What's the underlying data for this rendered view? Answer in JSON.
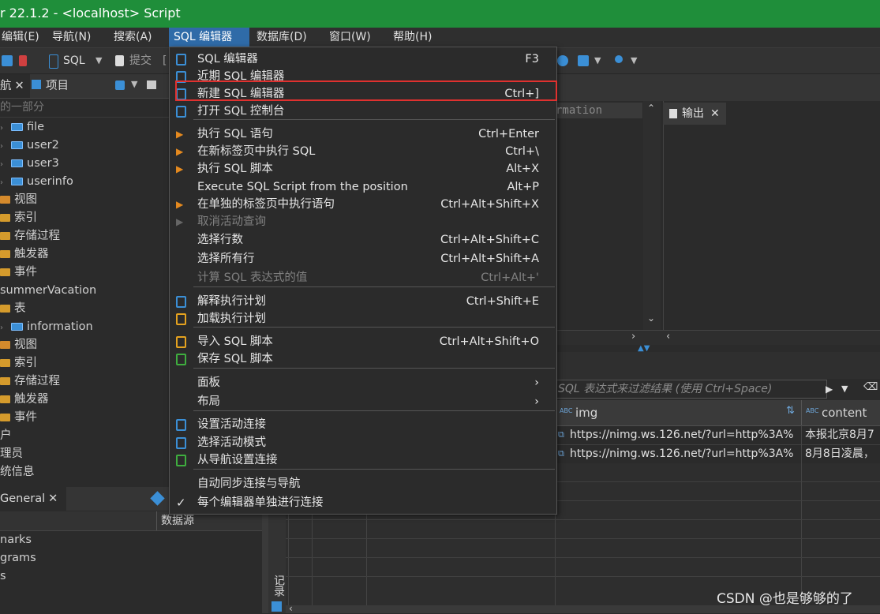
{
  "window": {
    "title": "r 22.1.2 - <localhost> Script"
  },
  "menubar": {
    "items": [
      {
        "label": "编辑(E)"
      },
      {
        "label": "导航(N)"
      },
      {
        "label": "搜索(A)"
      },
      {
        "label": "SQL 编辑器"
      },
      {
        "label": "数据库(D)"
      },
      {
        "label": "窗口(W)"
      },
      {
        "label": "帮助(H)"
      }
    ]
  },
  "toolbar": {
    "sql_label": "SQL",
    "submit_label": "提交"
  },
  "left_tabs": {
    "nav_label": "航",
    "project_label": "项目"
  },
  "filter_hint": "的一部分",
  "tree": [
    {
      "label": "file",
      "icon": "table-icon",
      "arrow": true
    },
    {
      "label": "user2",
      "icon": "table-icon",
      "arrow": true
    },
    {
      "label": "user3",
      "icon": "table-icon",
      "arrow": true
    },
    {
      "label": "userinfo",
      "icon": "table-icon",
      "arrow": true
    },
    {
      "label": "视图",
      "icon": "view-icon"
    },
    {
      "label": "索引",
      "icon": "folder-icon"
    },
    {
      "label": "存储过程",
      "icon": "folder-icon"
    },
    {
      "label": "触发器",
      "icon": "folder-icon"
    },
    {
      "label": "事件",
      "icon": "folder-icon"
    },
    {
      "label": "summerVacation",
      "icon": "none"
    },
    {
      "label": "表",
      "icon": "folder-icon"
    },
    {
      "label": "information",
      "icon": "table-icon",
      "arrow": true
    },
    {
      "label": "视图",
      "icon": "view-icon"
    },
    {
      "label": "索引",
      "icon": "folder-icon"
    },
    {
      "label": "存储过程",
      "icon": "folder-icon"
    },
    {
      "label": "触发器",
      "icon": "folder-icon"
    },
    {
      "label": "事件",
      "icon": "folder-icon"
    },
    {
      "label": "户",
      "icon": "none"
    },
    {
      "label": "理员",
      "icon": "none"
    },
    {
      "label": "统信息",
      "icon": "none"
    }
  ],
  "bottom_left": {
    "tab_label": "General",
    "column_label": "数据源",
    "rows": [
      "narks",
      "grams",
      "s"
    ]
  },
  "editor": {
    "text_fragment": "rmation"
  },
  "output": {
    "tab_label": "输出"
  },
  "results": {
    "filter_placeholder": "SQL 表达式来过滤结果 (使用 Ctrl+Space)",
    "columns": [
      {
        "label": "img",
        "type_badge": "ABC"
      },
      {
        "label": "content",
        "type_badge": "ABC"
      }
    ],
    "rows": [
      {
        "img": "https://nimg.ws.126.net/?url=http%3A%",
        "content": "本报北京8月7"
      },
      {
        "img": "https://nimg.ws.126.net/?url=http%3A%",
        "content": "8月8日凌晨，"
      }
    ],
    "side_label": "记录"
  },
  "sql_menu": {
    "groups": [
      [
        {
          "label": "SQL 编辑器",
          "shortcut": "F3",
          "icon": "sql-editor-icon"
        },
        {
          "label": "近期 SQL 编辑器",
          "shortcut": "",
          "icon": "recent-editor-icon"
        },
        {
          "label": "新建 SQL 编辑器",
          "shortcut": "Ctrl+]",
          "icon": "new-editor-icon"
        },
        {
          "label": "打开 SQL 控制台",
          "shortcut": "",
          "icon": "console-icon"
        }
      ],
      [
        {
          "label": "执行 SQL 语句",
          "shortcut": "Ctrl+Enter",
          "icon": "execute-icon"
        },
        {
          "label": "在新标签页中执行 SQL",
          "shortcut": "Ctrl+\\",
          "icon": "execute-new-tab-icon"
        },
        {
          "label": "执行 SQL 脚本",
          "shortcut": "Alt+X",
          "icon": "execute-script-icon"
        },
        {
          "label": "Execute SQL Script from the position",
          "shortcut": "Alt+P",
          "icon": "none"
        },
        {
          "label": "在单独的标签页中执行语句",
          "shortcut": "Ctrl+Alt+Shift+X",
          "icon": "execute-separate-icon"
        },
        {
          "label": "取消活动查询",
          "shortcut": "",
          "icon": "cancel-query-icon",
          "disabled": true
        },
        {
          "label": "选择行数",
          "shortcut": "Ctrl+Alt+Shift+C",
          "icon": "none"
        },
        {
          "label": "选择所有行",
          "shortcut": "Ctrl+Alt+Shift+A",
          "icon": "none"
        },
        {
          "label": "计算 SQL 表达式的值",
          "shortcut": "Ctrl+Alt+'",
          "icon": "none",
          "disabled": true
        }
      ],
      [
        {
          "label": "解释执行计划",
          "shortcut": "Ctrl+Shift+E",
          "icon": "explain-plan-icon"
        },
        {
          "label": "加载执行计划",
          "shortcut": "",
          "icon": "load-plan-icon"
        }
      ],
      [
        {
          "label": "导入 SQL 脚本",
          "shortcut": "Ctrl+Alt+Shift+O",
          "icon": "import-script-icon"
        },
        {
          "label": "保存 SQL 脚本",
          "shortcut": "",
          "icon": "save-script-icon"
        }
      ],
      [
        {
          "label": "面板",
          "shortcut": "›",
          "icon": "none"
        },
        {
          "label": "布局",
          "shortcut": "›",
          "icon": "none"
        }
      ],
      [
        {
          "label": "设置活动连接",
          "shortcut": "",
          "icon": "set-connection-icon"
        },
        {
          "label": "选择活动模式",
          "shortcut": "",
          "icon": "select-schema-icon"
        },
        {
          "label": "从导航设置连接",
          "shortcut": "",
          "icon": "sync-connection-icon"
        }
      ],
      [
        {
          "label": "自动同步连接与导航",
          "shortcut": "",
          "icon": "none"
        },
        {
          "label": "每个编辑器单独进行连接",
          "shortcut": "",
          "icon": "checkmark-icon"
        }
      ]
    ]
  },
  "watermark": "CSDN @也是够够的了",
  "colors": {
    "titlebar": "#1f8e3a",
    "menu_active": "#2f6ba8",
    "highlight": "#e0312f"
  }
}
